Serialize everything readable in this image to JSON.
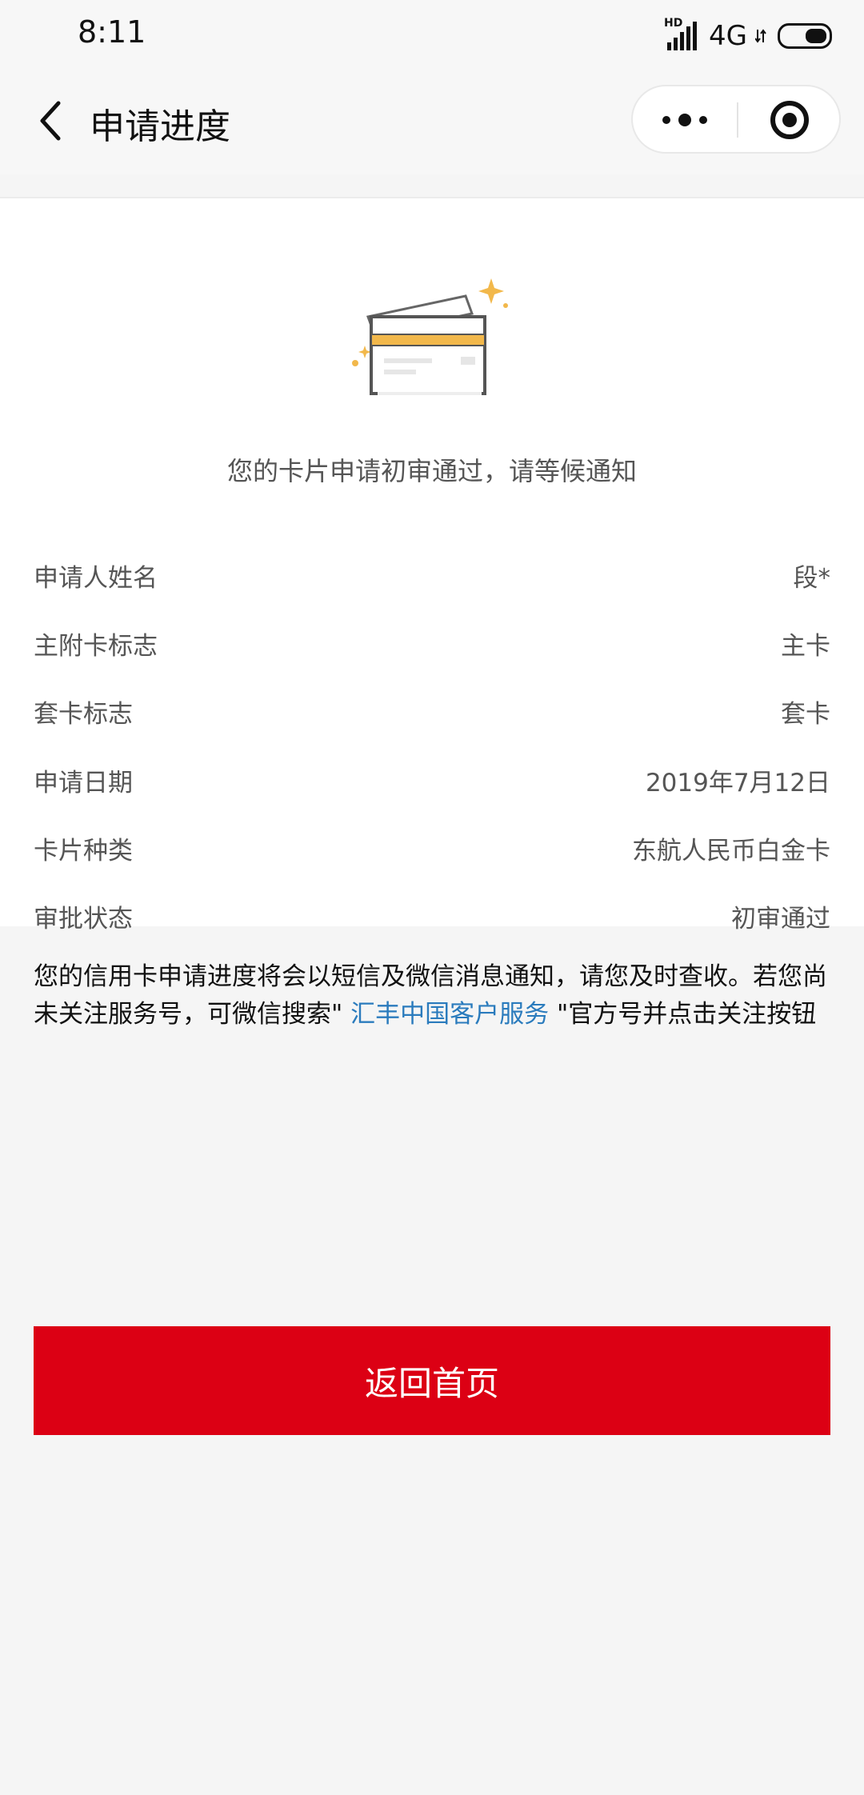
{
  "status_bar": {
    "time": "8:11",
    "network_badge": "HD",
    "network": "4G",
    "icons": [
      "signal-icon",
      "battery-icon"
    ]
  },
  "nav": {
    "title": "申请进度",
    "back_icon": "chevron-left-icon",
    "more_icon": "more-dots-icon",
    "close_icon": "target-circle-icon"
  },
  "hero": {
    "illustration": "credit-card-icon",
    "message": "您的卡片申请初审通过，请等候通知",
    "accent_color": "#f2b84b"
  },
  "details": [
    {
      "label": "申请人姓名",
      "value": "段*"
    },
    {
      "label": "主附卡标志",
      "value": "主卡"
    },
    {
      "label": "套卡标志",
      "value": "套卡"
    },
    {
      "label": "申请日期",
      "value": "2019年7月12日"
    },
    {
      "label": "卡片种类",
      "value": "东航人民币白金卡"
    },
    {
      "label": "审批状态",
      "value": "初审通过"
    }
  ],
  "notice": {
    "text_before": "您的信用卡申请进度将会以短信及微信消息通知，请您及时查收。若您尚未关注服务号，可微信搜索\"",
    "link_text": " 汇丰中国客户服务 ",
    "text_after": "\"官方号并点击关注按钮",
    "link_color": "#2a7bbd"
  },
  "actions": {
    "home_button_label": "返回首页",
    "home_button_color": "#dc0014"
  }
}
